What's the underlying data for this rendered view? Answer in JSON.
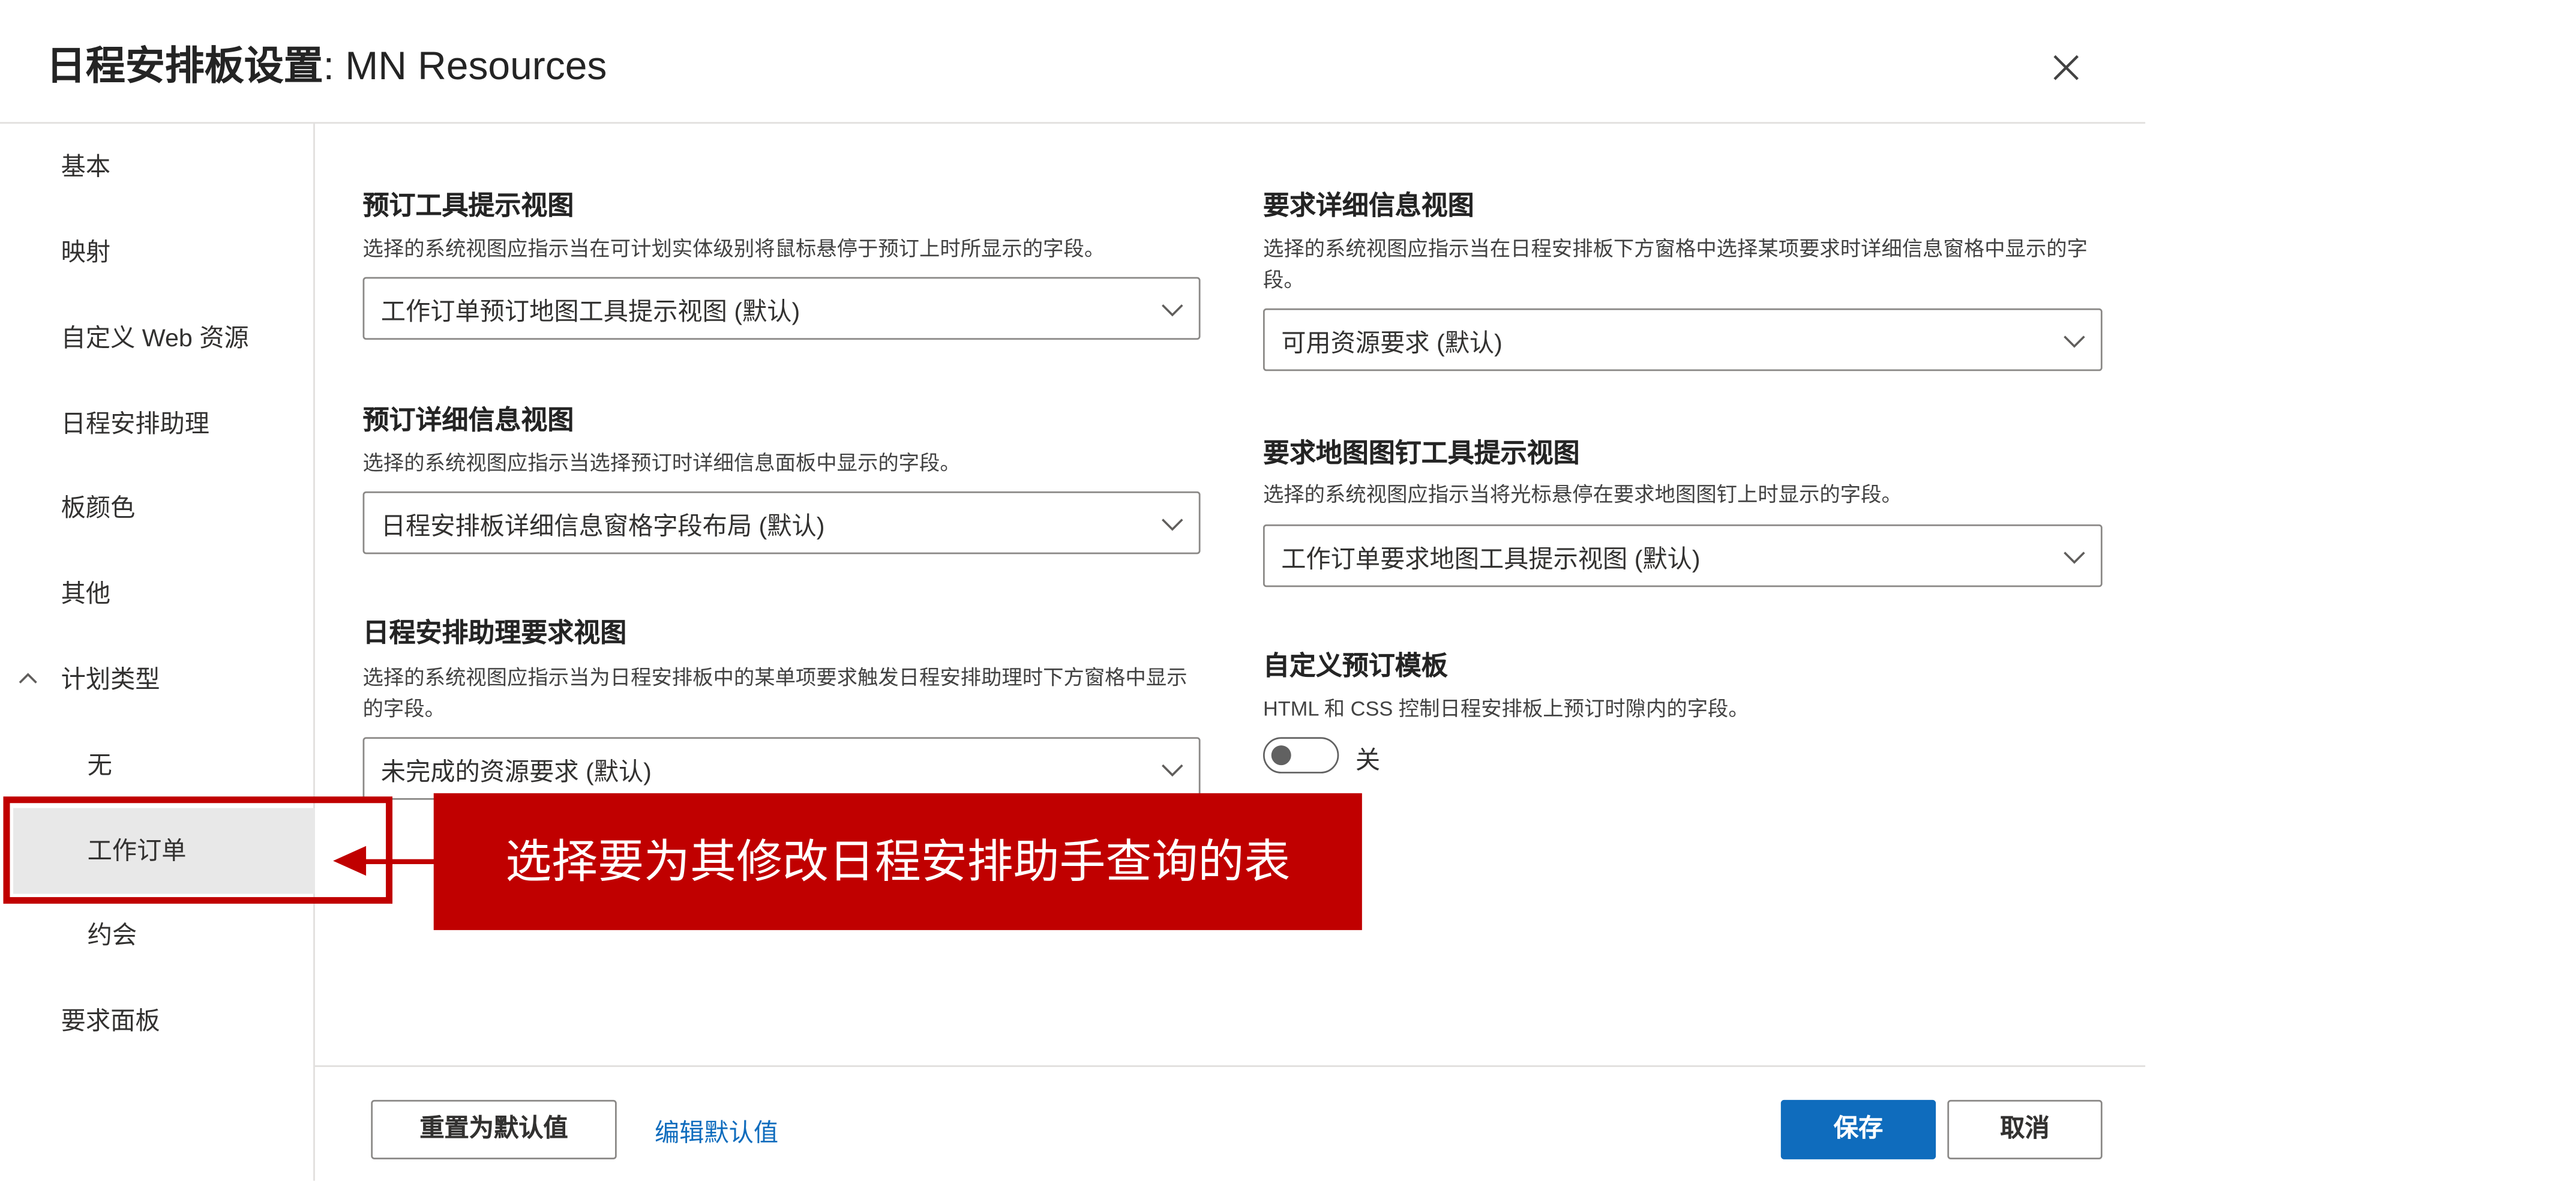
{
  "dialog": {
    "title_bold": "日程安排板设置",
    "title_rest": ": MN Resources",
    "close_icon": "close-icon"
  },
  "sidebar": {
    "items": [
      {
        "label": "基本"
      },
      {
        "label": "映射"
      },
      {
        "label": "自定义 Web 资源"
      },
      {
        "label": "日程安排助理"
      },
      {
        "label": "板颜色"
      },
      {
        "label": "其他"
      },
      {
        "label": "计划类型",
        "icon": "chevron-up-icon",
        "expanded": true
      },
      {
        "label": "无"
      },
      {
        "label": "工作订单",
        "selected": true
      },
      {
        "label": "约会"
      },
      {
        "label": "要求面板"
      }
    ]
  },
  "sections": {
    "booking_tooltip": {
      "title": "预订工具提示视图",
      "desc": "选择的系统视图应指示当在可计划实体级别将鼠标悬停于预订上时所显示的字段。",
      "value": "工作订单预订地图工具提示视图 (默认)"
    },
    "booking_details": {
      "title": "预订详细信息视图",
      "desc": "选择的系统视图应指示当选择预订时详细信息面板中显示的字段。",
      "value": "日程安排板详细信息窗格字段布局 (默认)"
    },
    "assistant_requirements": {
      "title": "日程安排助理要求视图",
      "desc": "选择的系统视图应指示当为日程安排板中的某单项要求触发日程安排助理时下方窗格中显示的字段。",
      "value": "未完成的资源要求 (默认)"
    },
    "requirement_details": {
      "title": "要求详细信息视图",
      "desc": "选择的系统视图应指示当在日程安排板下方窗格中选择某项要求时详细信息窗格中显示的字段。",
      "value": "可用资源要求 (默认)"
    },
    "requirement_map_tooltip": {
      "title": "要求地图图钉工具提示视图",
      "desc": "选择的系统视图应指示当将光标悬停在要求地图图钉上时显示的字段。",
      "value": "工作订单要求地图工具提示视图 (默认)"
    },
    "custom_template": {
      "title": "自定义预订模板",
      "desc": "HTML 和 CSS 控制日程安排板上预订时隙内的字段。",
      "toggle_label": "关",
      "toggle_on": false
    }
  },
  "footer": {
    "reset_label": "重置为默认值",
    "edit_defaults_label": "编辑默认值",
    "save_label": "保存",
    "cancel_label": "取消"
  },
  "annotation": {
    "callout_text": "选择要为其修改日程安排助手查询的表"
  },
  "colors": {
    "primary": "#0f6cbd",
    "annotation_red": "#c00000",
    "selected_bg": "#e8e8e8"
  }
}
